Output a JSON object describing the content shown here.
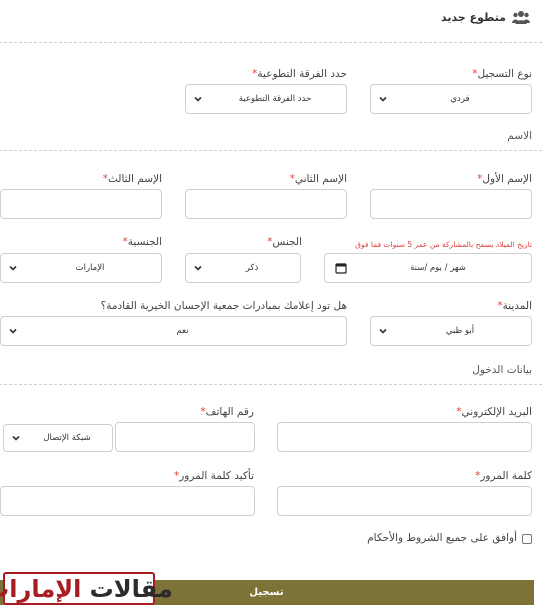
{
  "header": {
    "title": "متطوع جديد",
    "icon": "users-icon"
  },
  "registration": {
    "type": {
      "label": "نوع التسجيل",
      "value": "فردي"
    },
    "team": {
      "label": "حدد الفرقة التطوعية",
      "value": "حدد الفرقة التطوعية"
    }
  },
  "name_section": {
    "title": "الاسم",
    "first": {
      "label": "الإسم الأول",
      "value": ""
    },
    "second": {
      "label": "الإسم الثاني",
      "value": ""
    },
    "third": {
      "label": "الإسم الثالث",
      "value": ""
    }
  },
  "birth": {
    "label": "تاريخ الميلاد يسمح بالمشاركة من عمر 5 سنوات فما فوق",
    "placeholder": "mm/dd/yyyy",
    "display": "شهر / يوم /سنة"
  },
  "gender": {
    "label": "الجنس",
    "value": "ذكر"
  },
  "nationality": {
    "label": "الجنسية",
    "value": "الإمارات"
  },
  "city": {
    "label": "المدينة",
    "value": "أبو ظبي"
  },
  "notify": {
    "label": "هل تود إعلامك بمبادرات جمعية الإحسان الخيرية القادمة؟",
    "value": "نعم"
  },
  "login_section": {
    "title": "بيانات الدخول",
    "email": {
      "label": "البريد الإلكتروني"
    },
    "phone": {
      "label": "رقم الهاتف",
      "network": "شبكة الإتصال"
    },
    "password": {
      "label": "كلمة المرور"
    },
    "confirm": {
      "label": "تأكيد كلمة المرور"
    }
  },
  "terms": {
    "label": "أوافق على جميع الشروط والأحكام",
    "checked": false
  },
  "submit_label": "تسجيل",
  "watermark": {
    "part1": "مقالات",
    "part2": "الإمارات"
  },
  "colors": {
    "required": "#e0403a",
    "submit": "#7d7337",
    "watermark": "#a71d22"
  }
}
